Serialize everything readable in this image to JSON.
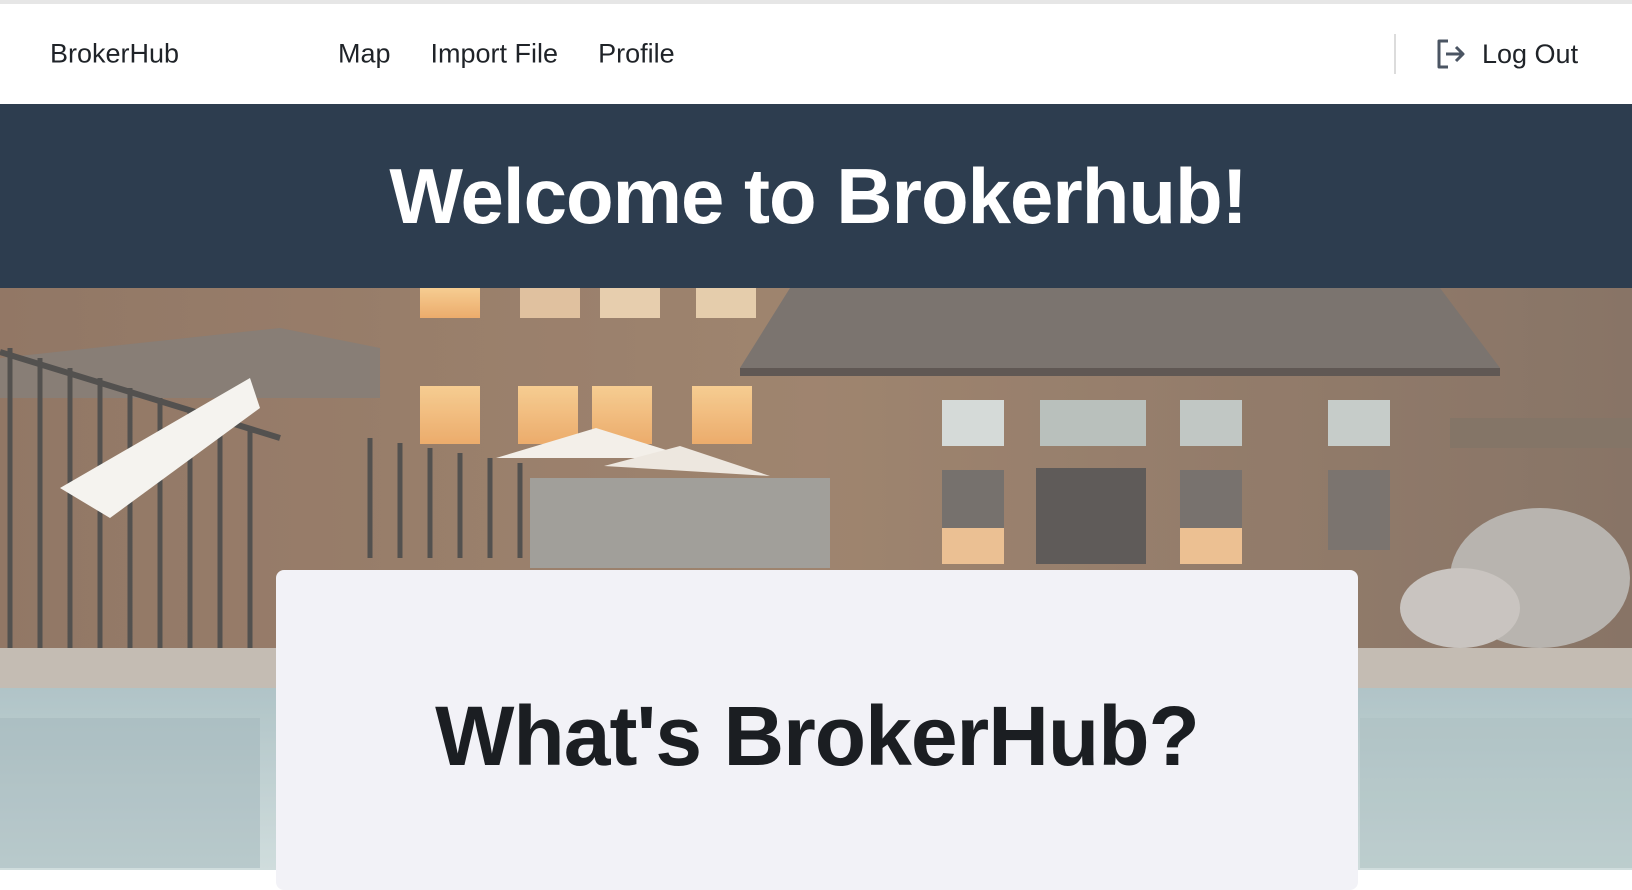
{
  "navbar": {
    "brand": "BrokerHub",
    "links": [
      "Map",
      "Import File",
      "Profile"
    ],
    "logout_label": "Log Out",
    "logout_icon": "log-out-icon"
  },
  "hero": {
    "title": "Welcome to Brokerhub!",
    "background": "#2d3d4f"
  },
  "background_photo": "lodge-with-pool-photo",
  "card": {
    "title": "What's BrokerHub?"
  },
  "colors": {
    "hero_band": "#2d3d4f",
    "card_bg": "#f2f2f7",
    "text_dark": "#1f2328"
  }
}
